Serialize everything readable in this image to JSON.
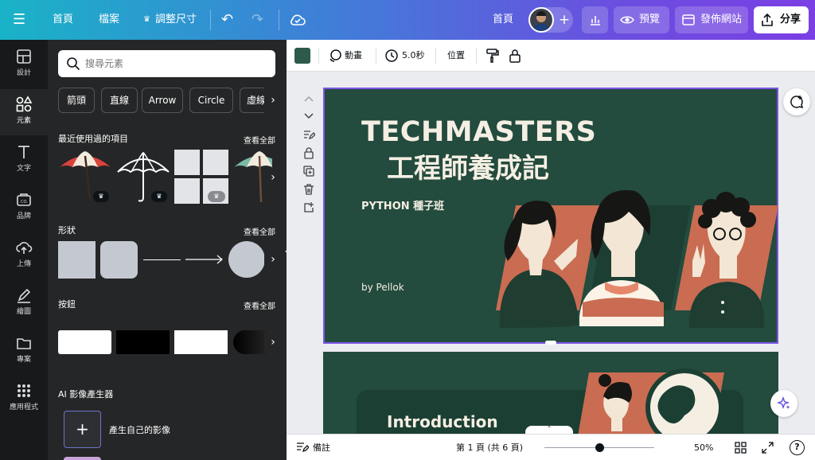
{
  "topbar": {
    "home": "首頁",
    "file": "檔案",
    "resize": "調整尺寸",
    "home_right": "首頁",
    "add": "+",
    "preview": "預覽",
    "publish": "發佈網站",
    "share": "分享"
  },
  "rail": {
    "items": [
      {
        "label": "設計",
        "icon": "layout-icon"
      },
      {
        "label": "元素",
        "icon": "shapes-icon"
      },
      {
        "label": "文字",
        "icon": "text-icon"
      },
      {
        "label": "品牌",
        "icon": "brand-icon"
      },
      {
        "label": "上傳",
        "icon": "upload-icon"
      },
      {
        "label": "繪圖",
        "icon": "draw-icon"
      },
      {
        "label": "專案",
        "icon": "folder-icon"
      },
      {
        "label": "應用程式",
        "icon": "apps-icon"
      }
    ]
  },
  "panel": {
    "search_placeholder": "搜尋元素",
    "chips": [
      "箭頭",
      "直線",
      "Arrow",
      "Circle",
      "虛線"
    ],
    "recent_title": "最近使用過的項目",
    "shapes_title": "形狀",
    "buttons_title": "按鈕",
    "see_all": "查看全部",
    "ai_title": "AI 影像產生器",
    "ai_create": "產生自己的影像"
  },
  "ctoolbar": {
    "color": "#2d5a4a",
    "animate": "動畫",
    "duration": "5.0秒",
    "position": "位置"
  },
  "slide1": {
    "title_en": "TECHMASTERS",
    "title_zh": "工程師養成記",
    "subtitle": "PYTHON 種子班",
    "author": "by Pellok"
  },
  "slide2": {
    "heading": "Introduction"
  },
  "bottombar": {
    "notes": "備註",
    "page": "第 1 頁 (共 6 頁)",
    "zoom": "50%",
    "zoom_level": 0.5,
    "help": "?"
  },
  "colors": {
    "accent": "#7d55e6",
    "slide_bg": "#234b3e",
    "terracotta": "#c96c52"
  }
}
